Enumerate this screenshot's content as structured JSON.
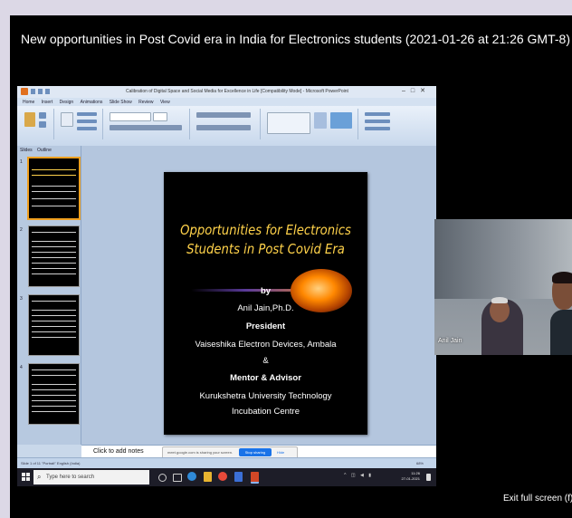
{
  "meeting": {
    "title": "New opportunities in Post Covid era in India for Electronics students (2021-01-26 at 21:26 GMT-8)",
    "exit_fullscreen_label": "Exit full screen (f)",
    "participant_name": "Anil Jain"
  },
  "powerpoint": {
    "window_title": "Calibration of Digital Space and Social Media for Excellence in Life [Compatibility Mode] - Microsoft PowerPoint",
    "tabs": [
      "Home",
      "Insert",
      "Design",
      "Animations",
      "Slide Show",
      "Review",
      "View"
    ],
    "panel_tabs": [
      "Slides",
      "Outline"
    ],
    "slide_numbers": [
      "1",
      "2",
      "3",
      "4"
    ],
    "notes_placeholder": "Click to add notes",
    "status_text": "Slide 1 of 11   \"Portrait\"   English (India)",
    "zoom_text": "68%"
  },
  "slide": {
    "title_line1": "Opportunities for Electronics",
    "title_line2": "Students in Post Covid Era",
    "by": "by",
    "author": "Anil Jain,Ph.D.",
    "role": "President",
    "org": "Vaiseshika Electron Devices, Ambala",
    "amp": "&",
    "role2": "Mentor & Advisor",
    "org2_line1": "Kurukshetra University Technology",
    "org2_line2": "Incubation Centre"
  },
  "share_bar": {
    "text": "meet.google.com is sharing your screen.",
    "stop_label": "Stop sharing",
    "hide_label": "Hide"
  },
  "taskbar": {
    "search_placeholder": "Type here to search",
    "time": "11:26",
    "date": "27-01-2021"
  },
  "colors": {
    "slide_title": "#ffd24a",
    "stop_sharing": "#1a73e8",
    "page_background": "#dcd8e6"
  }
}
